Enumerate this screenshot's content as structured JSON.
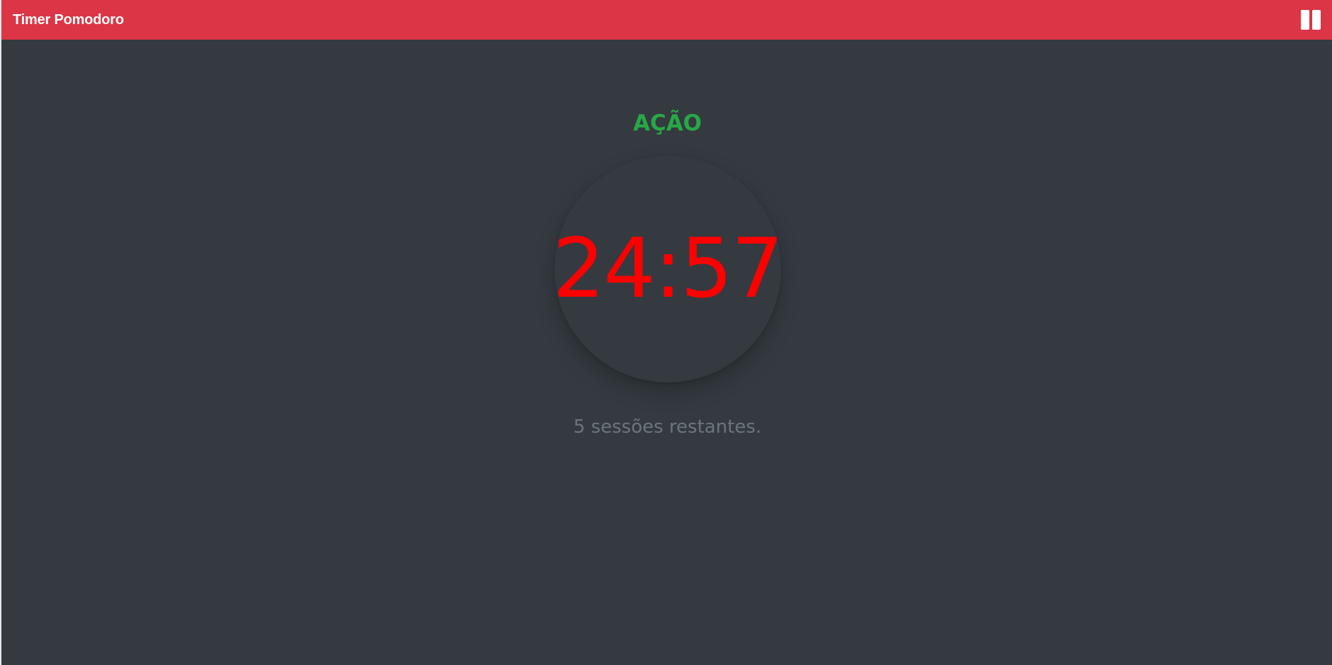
{
  "app": {
    "title": "Timer Pomodoro"
  },
  "controls": {
    "pause_icon": "pause-icon"
  },
  "timer": {
    "mode": "AÇÃO",
    "remaining": "24:57",
    "sessions_text": "5 sessões restantes."
  },
  "colors": {
    "topbar": "#dc3545",
    "background": "#343a40",
    "mode_text": "#28a745",
    "timer_text": "#ff0000",
    "sessions_text": "#6c757d"
  }
}
